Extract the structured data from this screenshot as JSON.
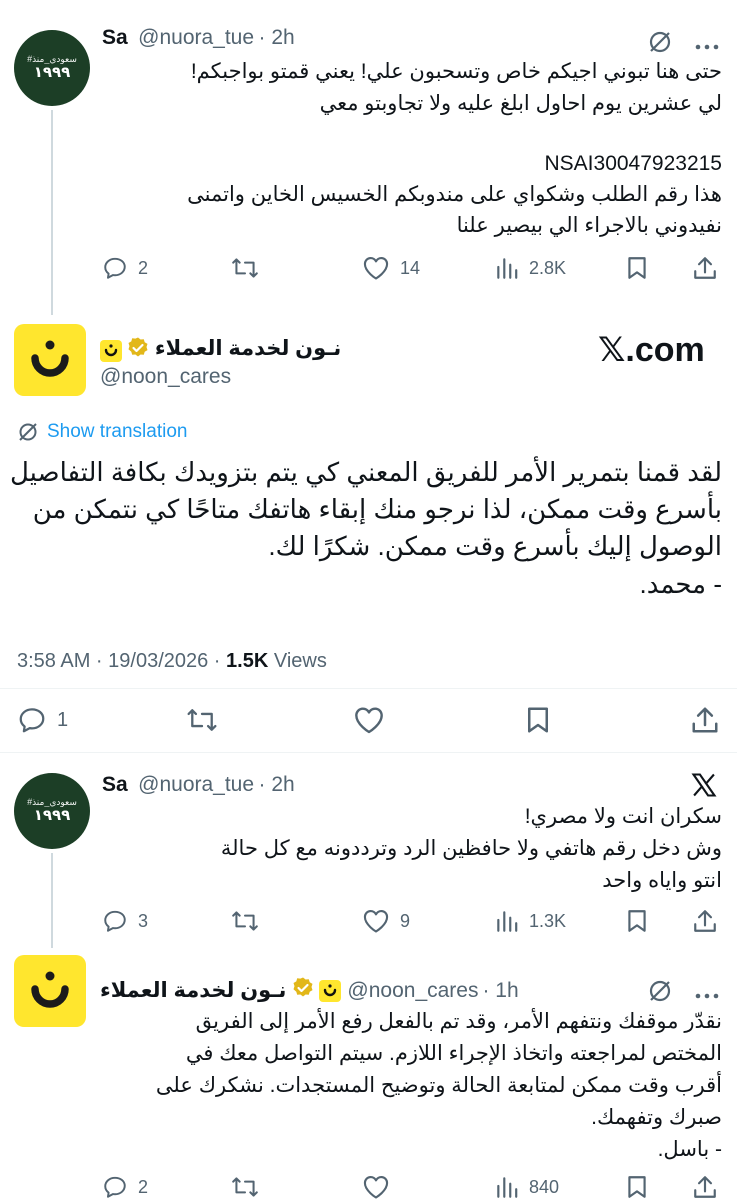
{
  "tweet1": {
    "avatar_line1": "#سعودي_منذ",
    "avatar_line2": "١٩٩٩",
    "name": "Sa",
    "handle": "@nuora_tue",
    "time": "· 2h",
    "lines": [
      "حتى هنا تبوني اجيكم خاص وتسحبون علي! يعني قمتو بواجبكم!",
      "لي عشرين يوم احاول ابلغ عليه ولا تجاوبتو معي",
      "NSAI30047923215",
      "هذا رقم الطلب وشكواي على مندوبكم الخسيس الخاين واتمنى",
      "نفيدوني بالاجراء الي بيصير علنا"
    ],
    "replies": "2",
    "likes": "14",
    "views": "2.8K"
  },
  "main_tweet": {
    "name": "نـون لخدمة العملاء",
    "handle": "@noon_cares",
    "watermark": "𝕏.com",
    "show_translation": "Show translation",
    "lines": [
      "لقد قمنا بتمرير الأمر للفريق المعني كي يتم بتزويدك بكافة التفاصيل",
      "بأسرع وقت ممكن، لذا نرجو منك إبقاء هاتفك متاحًا كي نتمكن من",
      "الوصول إليك بأسرع وقت ممكن. شكرًا لك.",
      "- محمد."
    ],
    "timestamp": "3:58 AM · 19/03/2026 · ",
    "views_count": "1.5K",
    "views_label": " Views",
    "replies": "1"
  },
  "tweet3": {
    "avatar_line1": "#سعودي_منذ",
    "avatar_line2": "١٩٩٩",
    "name": "Sa",
    "handle": "@nuora_tue",
    "time": "· 2h",
    "lines": [
      "سكران انت ولا مصري!",
      "وش دخل رقم هاتفي ولا حافظين الرد وترددونه مع كل حالة",
      "انتو واياه واحد"
    ],
    "replies": "3",
    "likes": "9",
    "views": "1.3K"
  },
  "tweet4": {
    "name": "نـون لخدمة العملاء",
    "handle": "@noon_cares",
    "time": "· 1h",
    "lines": [
      "نقدّر موقفك ونتفهم الأمر، وقد تم بالفعل رفع الأمر إلى الفريق",
      "المختص لمراجعته واتخاذ الإجراء اللازم. سيتم التواصل معك في",
      "أقرب وقت ممكن لمتابعة الحالة وتوضيح المستجدات. نشكرك على",
      "صبرك وتفهمك.",
      "- باسل."
    ],
    "replies": "2",
    "views": "840"
  },
  "colors": {
    "accent": "#1d9bf0",
    "muted": "#536471",
    "verified": "#e2b719",
    "brand_yellow": "#ffe62e",
    "avatar_green": "#1c3e26"
  }
}
